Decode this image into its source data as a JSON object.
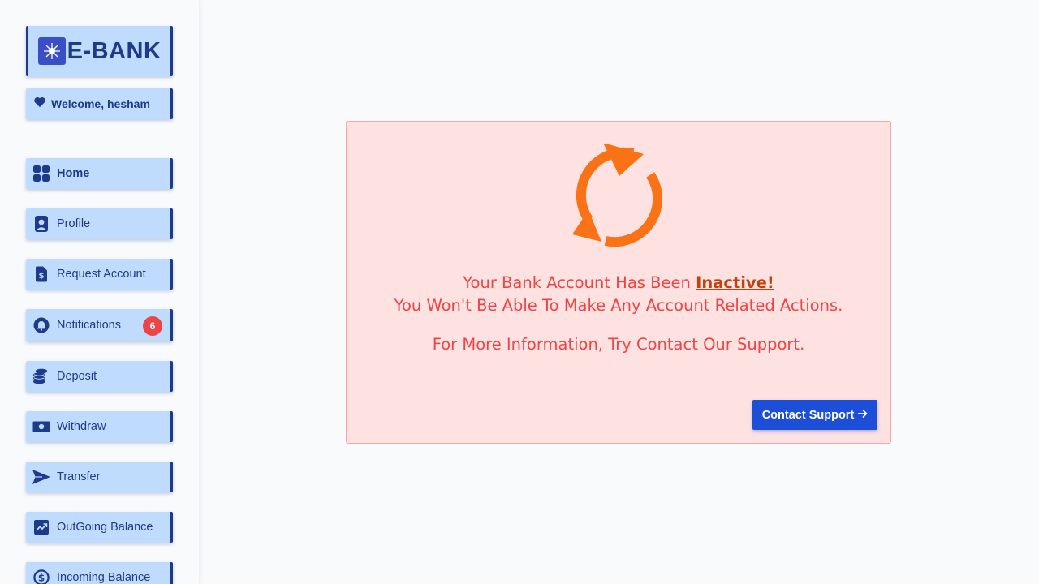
{
  "brand": {
    "name": "E-BANK",
    "icon": "sparkle-logo-icon"
  },
  "welcome": {
    "text": "Welcome, hesham",
    "icon": "heart-icon"
  },
  "nav": [
    {
      "label": "Home",
      "icon": "grid-icon",
      "active": true
    },
    {
      "label": "Profile",
      "icon": "user-badge-icon"
    },
    {
      "label": "Request Account",
      "icon": "dollar-document-icon"
    },
    {
      "label": "Notifications",
      "icon": "bell-icon",
      "badge": "6"
    },
    {
      "label": "Deposit",
      "icon": "coins-icon"
    },
    {
      "label": "Withdraw",
      "icon": "cash-icon"
    },
    {
      "label": "Transfer",
      "icon": "send-icon"
    },
    {
      "label": "OutGoing Balance",
      "icon": "trend-up-icon"
    },
    {
      "label": "Incoming Balance",
      "icon": "dollar-circle-icon"
    }
  ],
  "status": {
    "icon": "refresh-icon",
    "line1_prefix": "Your Bank Account Has Been ",
    "line1_status": "Inactive!",
    "line2": "You Won't Be Able To Make Any Account Related Actions.",
    "line3": "For More Information, Try Contact Our Support.",
    "button_label": "Contact Support",
    "button_icon": "arrow-right-icon"
  },
  "colors": {
    "accent": "#1e3a8a",
    "nav_bg": "#bfdbfe",
    "alert_bg": "#fee2e2",
    "alert_text": "#ef4444",
    "status_highlight": "#c2410c",
    "icon_orange": "#f97316",
    "button": "#1d4ed8",
    "badge": "#ef4444"
  }
}
